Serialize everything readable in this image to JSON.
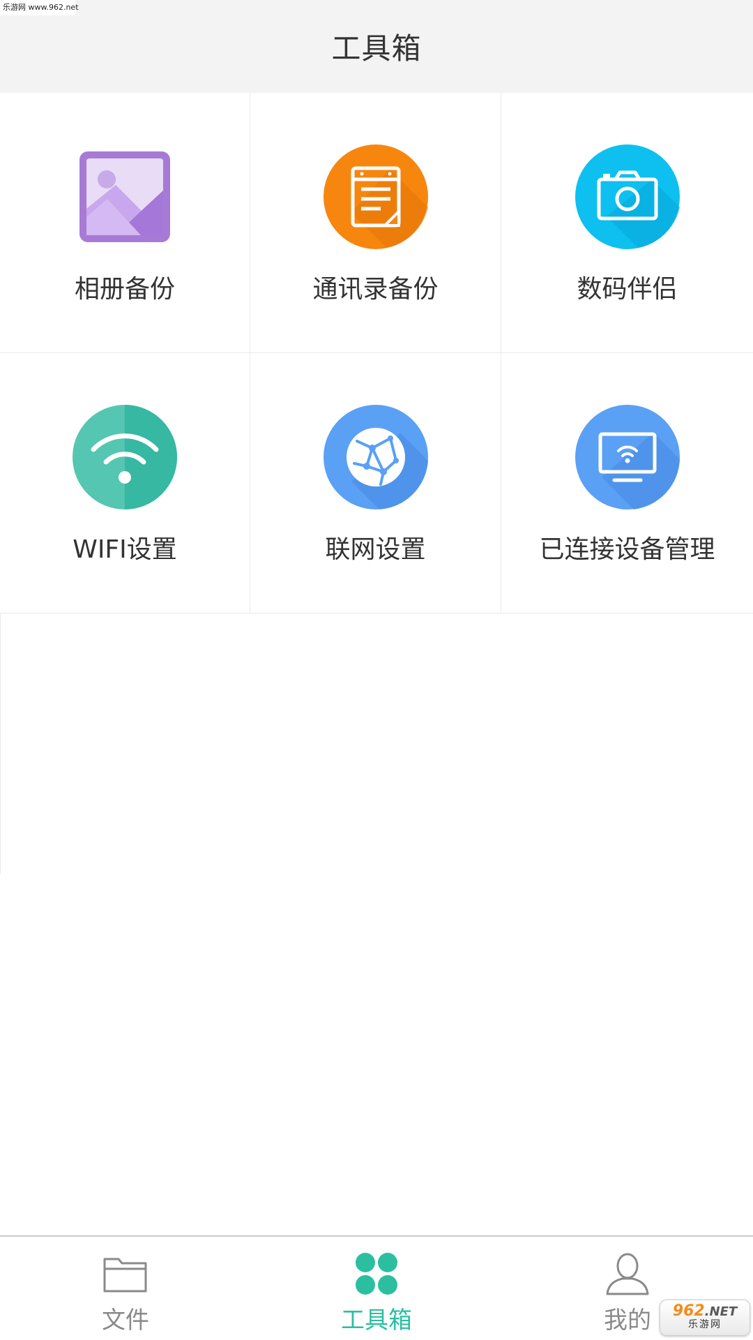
{
  "watermark": {
    "top_text": "乐游网 www.962.net",
    "brand_number": "962",
    "brand_suffix": ".NET",
    "brand_sub": "乐游网"
  },
  "header": {
    "title": "工具箱"
  },
  "tools": [
    {
      "label": "相册备份",
      "icon": "photo-album-icon",
      "color": "#a87ad6"
    },
    {
      "label": "通讯录备份",
      "icon": "contacts-book-icon",
      "color": "#f7860f"
    },
    {
      "label": "数码伴侣",
      "icon": "camera-icon",
      "color": "#0ec0f0"
    },
    {
      "label": "WIFI设置",
      "icon": "wifi-icon",
      "color": "#44c4ad"
    },
    {
      "label": "联网设置",
      "icon": "network-globe-icon",
      "color": "#5aa0f5"
    },
    {
      "label": "已连接设备管理",
      "icon": "connected-display-icon",
      "color": "#5aa0f5"
    }
  ],
  "tabbar": {
    "items": [
      {
        "label": "文件",
        "icon": "folder-icon",
        "active": false
      },
      {
        "label": "工具箱",
        "icon": "toolbox-grid-icon",
        "active": true
      },
      {
        "label": "我的",
        "icon": "user-icon",
        "active": false
      }
    ],
    "active_color": "#2bbfa0",
    "inactive_color": "#8a8a8a"
  }
}
